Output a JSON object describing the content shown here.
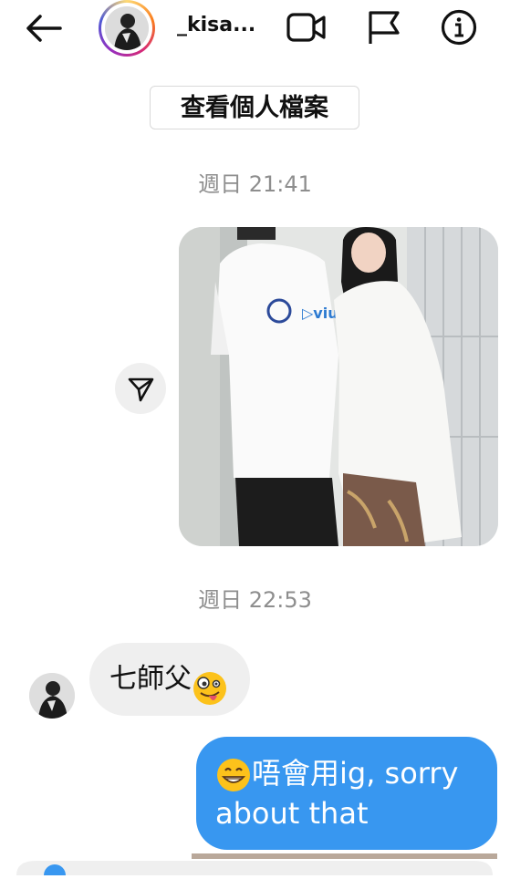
{
  "header": {
    "username": "_kisa...",
    "icons": [
      "back-arrow-icon",
      "video-camera-icon",
      "flag-icon",
      "info-icon"
    ]
  },
  "profile_button": {
    "label": "查看個人檔案"
  },
  "messages": [
    {
      "timestamp": "週日 21:41"
    },
    {
      "timestamp": "週日 22:53"
    }
  ],
  "incoming": {
    "text": "七師父"
  },
  "outgoing": {
    "line1": "唔會用ig, sorry",
    "line2": "about that"
  },
  "colors": {
    "accent": "#3897f0",
    "bubble_in": "#efefef",
    "timestamp": "#8e8e8e"
  }
}
